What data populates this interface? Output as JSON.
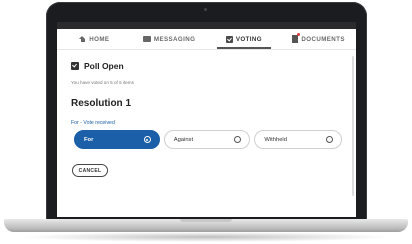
{
  "nav": {
    "items": [
      {
        "label": "HOME",
        "icon": "home-icon"
      },
      {
        "label": "MESSAGING",
        "icon": "messaging-icon"
      },
      {
        "label": "VOTING",
        "icon": "voting-icon",
        "active": true
      },
      {
        "label": "DOCUMENTS",
        "icon": "documents-icon",
        "badge": "notification-dot"
      }
    ]
  },
  "poll": {
    "title": "Poll Open",
    "voted_note": "You have voted on 5 of 5 items"
  },
  "resolution": {
    "title": "Resolution 1",
    "status": "For - Vote received",
    "options": [
      {
        "label": "For",
        "selected": true
      },
      {
        "label": "Against",
        "selected": false
      },
      {
        "label": "Withheld",
        "selected": false
      }
    ]
  },
  "actions": {
    "cancel_label": "CANCEL"
  },
  "colors": {
    "accent": "#1b5fa8",
    "notification": "#e03b3b"
  }
}
